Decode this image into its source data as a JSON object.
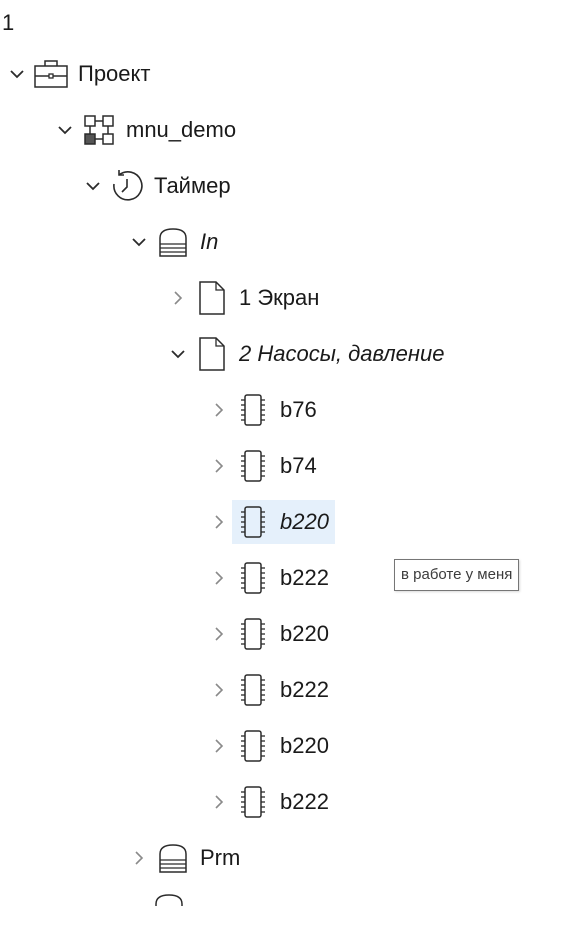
{
  "header": {
    "label": "1"
  },
  "tree": {
    "project": {
      "label": "Проект",
      "icon": "briefcase-icon",
      "expanded": true
    },
    "mnu_demo": {
      "label": "mnu_demo",
      "icon": "diagram-icon",
      "expanded": true
    },
    "timer": {
      "label": "Таймер",
      "icon": "timer-icon",
      "expanded": true
    },
    "in": {
      "label": "In",
      "icon": "database-icon",
      "expanded": true
    },
    "screen1": {
      "label": "1 Экран",
      "icon": "page-icon",
      "expanded": false
    },
    "screen2": {
      "label": "2 Насосы, давление",
      "icon": "page-icon",
      "expanded": true
    },
    "blocks": [
      {
        "label": "b76",
        "icon": "chip-icon"
      },
      {
        "label": "b74",
        "icon": "chip-icon"
      },
      {
        "label": "b220",
        "icon": "chip-icon",
        "selected": true
      },
      {
        "label": "b222",
        "icon": "chip-icon"
      },
      {
        "label": "b220",
        "icon": "chip-icon"
      },
      {
        "label": "b222",
        "icon": "chip-icon"
      },
      {
        "label": "b220",
        "icon": "chip-icon"
      },
      {
        "label": "b222",
        "icon": "chip-icon"
      }
    ],
    "prm": {
      "label": "Prm",
      "icon": "database-icon",
      "expanded": false
    }
  },
  "tooltip": {
    "text": "в работе у меня"
  },
  "colors": {
    "selection": "#e5f0fb",
    "icon_stroke": "#2b2b2b",
    "chevron": "#8a8a8a"
  }
}
